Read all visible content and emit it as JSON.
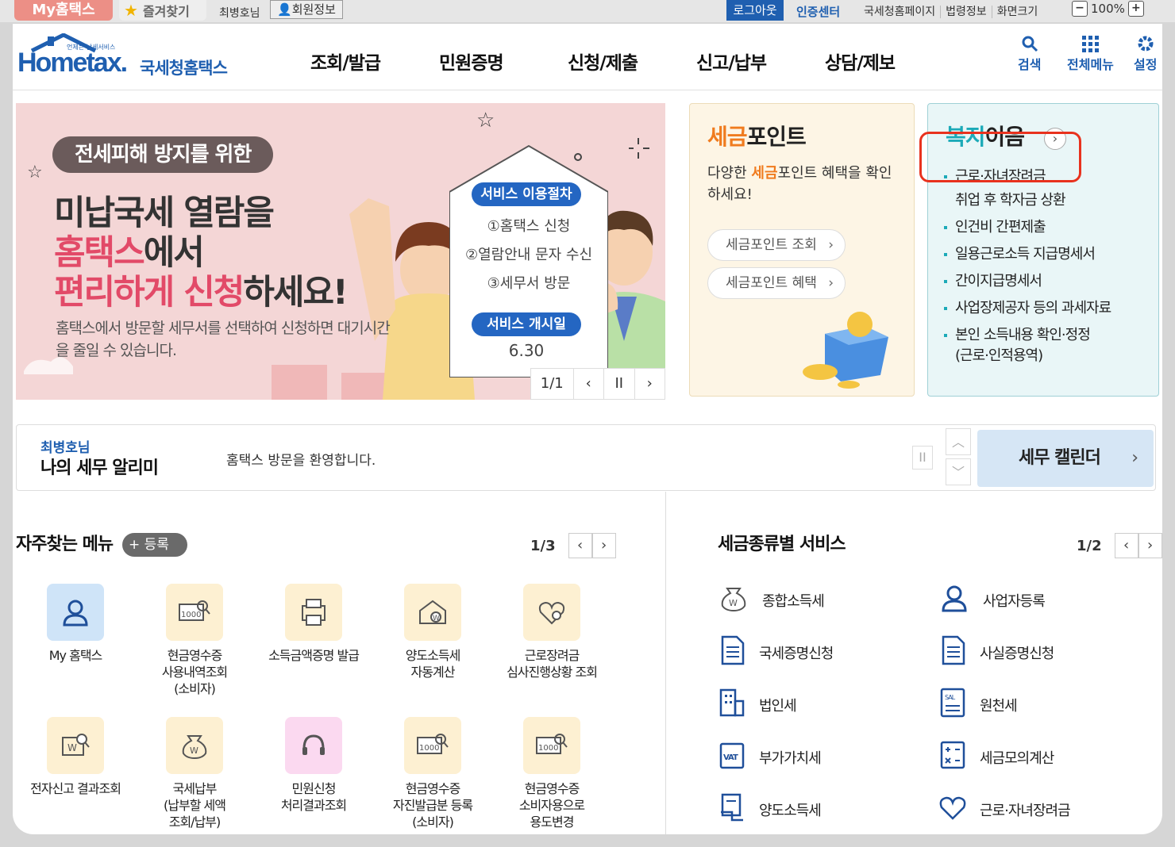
{
  "topbar": {
    "my_hometax": "My홈택스",
    "favorites": "즐겨찾기",
    "user": "최병호님",
    "member_info": "회원정보",
    "logout": "로그아웃",
    "cert_center": "인증센터",
    "links": [
      "국세청홈페이지",
      "법령정보",
      "화면크기"
    ],
    "zoom_minus": "−",
    "zoom_value": "100%",
    "zoom_plus": "+"
  },
  "header": {
    "logo_small": "언제든 납세서비스",
    "logo_main": "Hometax.",
    "logo_sub": "국세청홈택스",
    "nav": [
      "조회/발급",
      "민원증명",
      "신청/제출",
      "신고/납부",
      "상담/제보"
    ],
    "search": "검색",
    "all_menu": "전체메뉴",
    "settings": "설정"
  },
  "banner": {
    "pill": "전세피해 방지를 위한",
    "line1": "미납국세 열람을",
    "line2_red": "홈택스",
    "line2_dark": "에서",
    "line3_red": "편리하게 신청",
    "line3_dark": "하세요!",
    "desc": "홈택스에서 방문할 세무서를 선택하여 신청하면 대기시간을 줄일 수 있습니다.",
    "steps_title": "서비스 이용절차",
    "steps": [
      "①홈택스 신청",
      "②열람안내 문자 수신",
      "③세무서 방문"
    ],
    "open_title": "서비스 개시일",
    "open_date": "6.30",
    "counter": "1/1",
    "prev": "‹",
    "pause": "II",
    "next": "›"
  },
  "tax_point": {
    "title_accent": "세금",
    "title_rest": "포인트",
    "desc_pre": "다양한 ",
    "desc_accent": "세금",
    "desc_post": "포인트 혜택을 확인하세요!",
    "buttons": [
      "세금포인트 조회",
      "세금포인트 혜택"
    ],
    "chevron": "›"
  },
  "welfare": {
    "title_accent": "복지",
    "title_rest": "이음",
    "more": "›",
    "items": [
      "근로·자녀장려금",
      "취업 후 학자금 상환",
      "인건비 간편제출",
      "일용근로소득 지급명세서",
      "간이지급명세서",
      "사업장제공자 등의 과세자료",
      "본인 소득내용 확인·정정",
      "(근로·인적용역)"
    ]
  },
  "alarm": {
    "name": "최병호님",
    "title": "나의 세무 알리미",
    "message": "홈택스 방문을 환영합니다.",
    "pause": "II",
    "up": "︿",
    "down": "﹀",
    "calendar": "세무 캘린더",
    "calendar_arrow": "›"
  },
  "favorites": {
    "title": "자주찾는 메뉴",
    "add": "+ 등록",
    "page": "1/3",
    "prev": "‹",
    "next": "›",
    "items": [
      {
        "label": "My 홈택스",
        "icon": "person-icon",
        "bg": "#cfe4f8"
      },
      {
        "label": "현금영수증\n사용내역조회\n(소비자)",
        "icon": "receipt-search-icon",
        "bg": "#fdf0d2"
      },
      {
        "label": "소득금액증명 발급",
        "icon": "certificate-print-icon",
        "bg": "#fdf0d2"
      },
      {
        "label": "양도소득세\n자동계산",
        "icon": "house-won-icon",
        "bg": "#fdf0d2"
      },
      {
        "label": "근로장려금\n심사진행상황 조회",
        "icon": "heart-search-icon",
        "bg": "#fdf0d2"
      },
      {
        "label": "전자신고 결과조회",
        "icon": "won-search-icon",
        "bg": "#fdf0d2"
      },
      {
        "label": "국세납부\n(납부할 세액\n조회/납부)",
        "icon": "money-bag-icon",
        "bg": "#fdf0d2"
      },
      {
        "label": "민원신청\n처리결과조회",
        "icon": "headset-icon",
        "bg": "#fbd9f0"
      },
      {
        "label": "현금영수증\n자진발급분 등록\n(소비자)",
        "icon": "receipt-search-icon",
        "bg": "#fdf0d2"
      },
      {
        "label": "현금영수증\n소비자용으로\n용도변경",
        "icon": "receipt-search-icon",
        "bg": "#fdf0d2"
      }
    ]
  },
  "tax_services": {
    "title": "세금종류별 서비스",
    "page": "1/2",
    "prev": "‹",
    "next": "›",
    "items": [
      {
        "label": "종합소득세",
        "icon": "money-bag-icon"
      },
      {
        "label": "사업자등록",
        "icon": "person-icon"
      },
      {
        "label": "국세증명신청",
        "icon": "document-icon"
      },
      {
        "label": "사실증명신청",
        "icon": "document-icon"
      },
      {
        "label": "법인세",
        "icon": "building-icon"
      },
      {
        "label": "원천세",
        "icon": "salary-icon"
      },
      {
        "label": "부가가치세",
        "icon": "vat-icon"
      },
      {
        "label": "세금모의계산",
        "icon": "calculator-icon"
      },
      {
        "label": "양도소득세",
        "icon": "transfer-icon"
      },
      {
        "label": "근로·자녀장려금",
        "icon": "heart-icon"
      }
    ]
  },
  "colors": {
    "brand_blue": "#1f5fb0",
    "accent_orange": "#f07b1e",
    "teal": "#1caab8",
    "highlight_red": "#e8321e"
  }
}
